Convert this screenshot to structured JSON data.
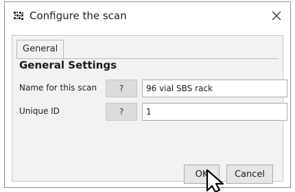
{
  "window": {
    "title": "Configure the scan",
    "close_icon": "close-icon",
    "app_icon": "app-grid-icon"
  },
  "tabs": [
    {
      "label": "General",
      "selected": true
    }
  ],
  "section": {
    "heading": "General Settings"
  },
  "fields": [
    {
      "label": "Name for this scan",
      "help_label": "?",
      "value": "96 vial SBS rack"
    },
    {
      "label": "Unique ID",
      "help_label": "?",
      "value": "1"
    }
  ],
  "buttons": {
    "ok_label": "OK",
    "cancel_label": "Cancel"
  }
}
